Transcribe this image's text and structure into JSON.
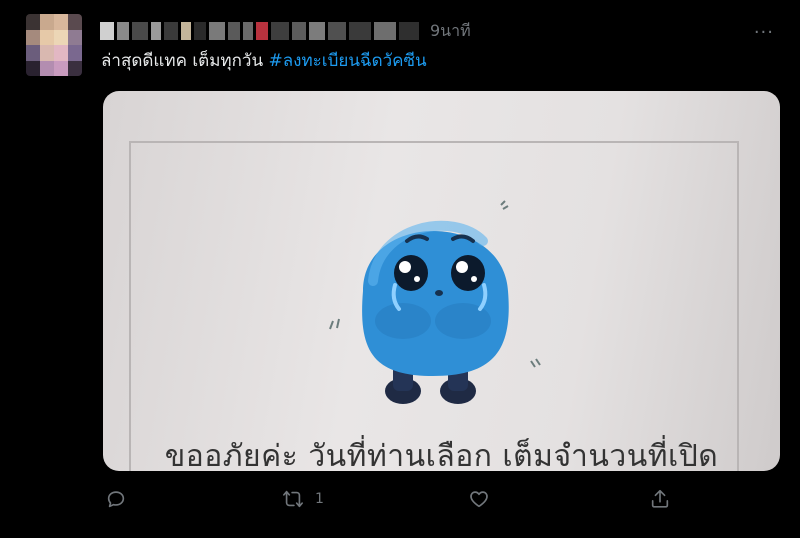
{
  "tweet": {
    "timestamp": "9นาที",
    "text_plain": "ล่าสุดดีแทค เต็มทุกวัน ",
    "hashtag": "#ลงทะเบียนฉีดวัคซีน",
    "more_label": "···"
  },
  "media": {
    "caption": "ขออภัยค่ะ วันที่ท่านเลือก เต็มจำนวนที่เปิด"
  },
  "actions": {
    "reply": {
      "icon": "reply-icon",
      "count": ""
    },
    "retweet": {
      "icon": "retweet-icon",
      "count": "1"
    },
    "like": {
      "icon": "heart-icon",
      "count": ""
    },
    "share": {
      "icon": "share-icon",
      "count": ""
    }
  },
  "colors": {
    "background": "#000000",
    "text": "#e7e9ea",
    "muted": "#71767b",
    "hashtag": "#1d9bf0"
  }
}
